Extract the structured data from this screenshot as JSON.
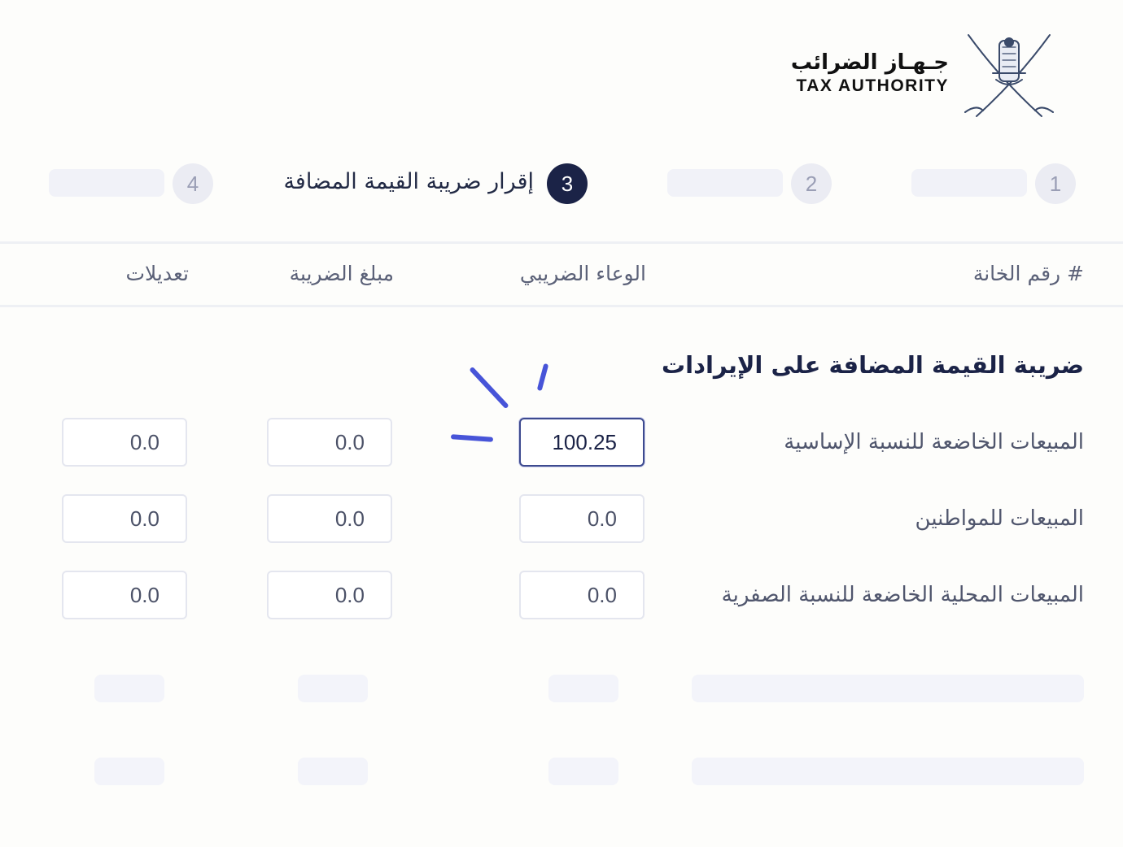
{
  "header": {
    "logo_arabic": "جـهـاز الضرائب",
    "logo_english": "TAX AUTHORITY",
    "emblem_icon": "oman-emblem-icon"
  },
  "stepper": {
    "steps": [
      {
        "number": "1",
        "label": "",
        "active": false
      },
      {
        "number": "2",
        "label": "",
        "active": false
      },
      {
        "number": "3",
        "label": "إقرار ضريبة القيمة المضافة",
        "active": true
      },
      {
        "number": "4",
        "label": "",
        "active": false
      }
    ]
  },
  "table": {
    "headers": {
      "box_number": "# رقم الخانة",
      "tax_base": "الوعاء الضريبي",
      "tax_amount": "مبلغ الضريبة",
      "adjustments": "تعديلات"
    },
    "section_title": "ضريبة القيمة المضافة على الإيرادات",
    "rows": [
      {
        "label": "المبيعات الخاضعة للنسبة الإساسية",
        "tax_base": "100.25",
        "tax_amount": "0.0",
        "adjustments": "0.0",
        "focused": true
      },
      {
        "label": "المبيعات للمواطنين",
        "tax_base": "0.0",
        "tax_amount": "0.0",
        "adjustments": "0.0",
        "focused": false
      },
      {
        "label": "المبيعات المحلية الخاضعة للنسبة الصفرية",
        "tax_base": "0.0",
        "tax_amount": "0.0",
        "adjustments": "0.0",
        "focused": false
      }
    ]
  },
  "colors": {
    "primary": "#1b2347",
    "accent": "#4754d8",
    "muted": "#ebecf3"
  }
}
